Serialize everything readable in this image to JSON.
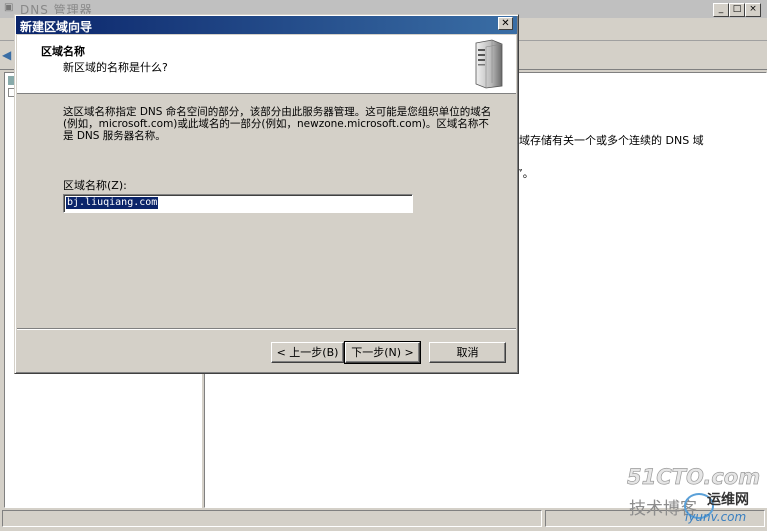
{
  "background_window": {
    "title": "DNS 管理器",
    "description_line_1": "域存储有关一个或多个连续的 DNS 域",
    "description_line_2": "”。"
  },
  "wizard": {
    "title": "新建区域向导",
    "close_label": "✕",
    "heading": "区域名称",
    "subheading": "新区域的名称是什么?",
    "description": "这区域名称指定 DNS 命名空间的部分，该部分由此服务器管理。这可能是您组织单位的域名(例如，microsoft.com)或此域名的一部分(例如，newzone.microsoft.com)。区域名称不是 DNS 服务器名称。",
    "zone_name_label": "区域名称(Z):",
    "zone_name_value": "bj.liuqiang.com",
    "back_button": "< 上一步(B)",
    "next_button": "下一步(N) >",
    "cancel_button": "取消"
  },
  "watermark": {
    "brand": "51CTO.com",
    "line": "技术博客",
    "site": "运维网",
    "url": "iyunv.com"
  },
  "colors": {
    "title_gradient_start": "#0a246a",
    "title_gradient_end": "#3a6ea5",
    "selection": "#0a246a",
    "face": "#d4d0c8"
  }
}
